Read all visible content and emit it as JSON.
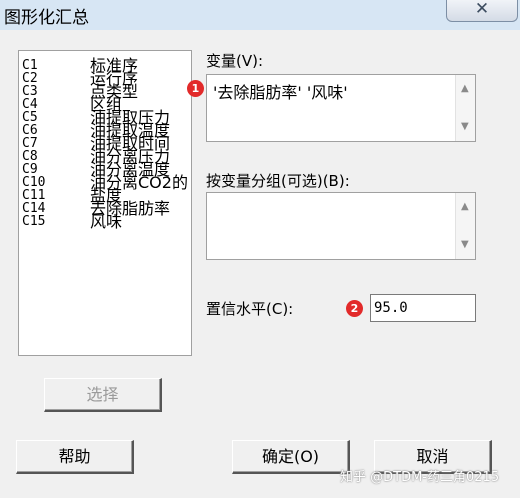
{
  "window": {
    "title": "图形化汇总",
    "close_icon": "✕"
  },
  "variables": [
    {
      "id": "C1",
      "name": "标准序"
    },
    {
      "id": "C2",
      "name": "运行序"
    },
    {
      "id": "C3",
      "name": "点类型"
    },
    {
      "id": "C4",
      "name": "区组"
    },
    {
      "id": "C5",
      "name": "油提取压力"
    },
    {
      "id": "C6",
      "name": "油提取温度"
    },
    {
      "id": "C7",
      "name": "油提取时间"
    },
    {
      "id": "C8",
      "name": "油分离压力"
    },
    {
      "id": "C9",
      "name": "油分离温度"
    },
    {
      "id": "C10",
      "name": "油分离CO2的"
    },
    {
      "id": "C11",
      "name": "盐度"
    },
    {
      "id": "C14",
      "name": "去除脂肪率"
    },
    {
      "id": "C15",
      "name": "风味"
    }
  ],
  "fields": {
    "variables_label": "变量(V):",
    "variables_value": "'去除脂肪率' '风味'",
    "byvars_label": "按变量分组(可选)(B):",
    "byvars_value": "",
    "confidence_label": "置信水平(C):",
    "confidence_value": "95.0"
  },
  "buttons": {
    "select": "选择",
    "help": "帮助",
    "ok": "确定(O)",
    "cancel": "取消"
  },
  "annotations": {
    "badge1": "1",
    "badge2": "2"
  },
  "watermark": "知乎 @DTDM-药三角0215",
  "colors": {
    "badge": "#e22a2a",
    "titlebar": "#d7e6f4",
    "dialog": "#f0f0f0"
  }
}
